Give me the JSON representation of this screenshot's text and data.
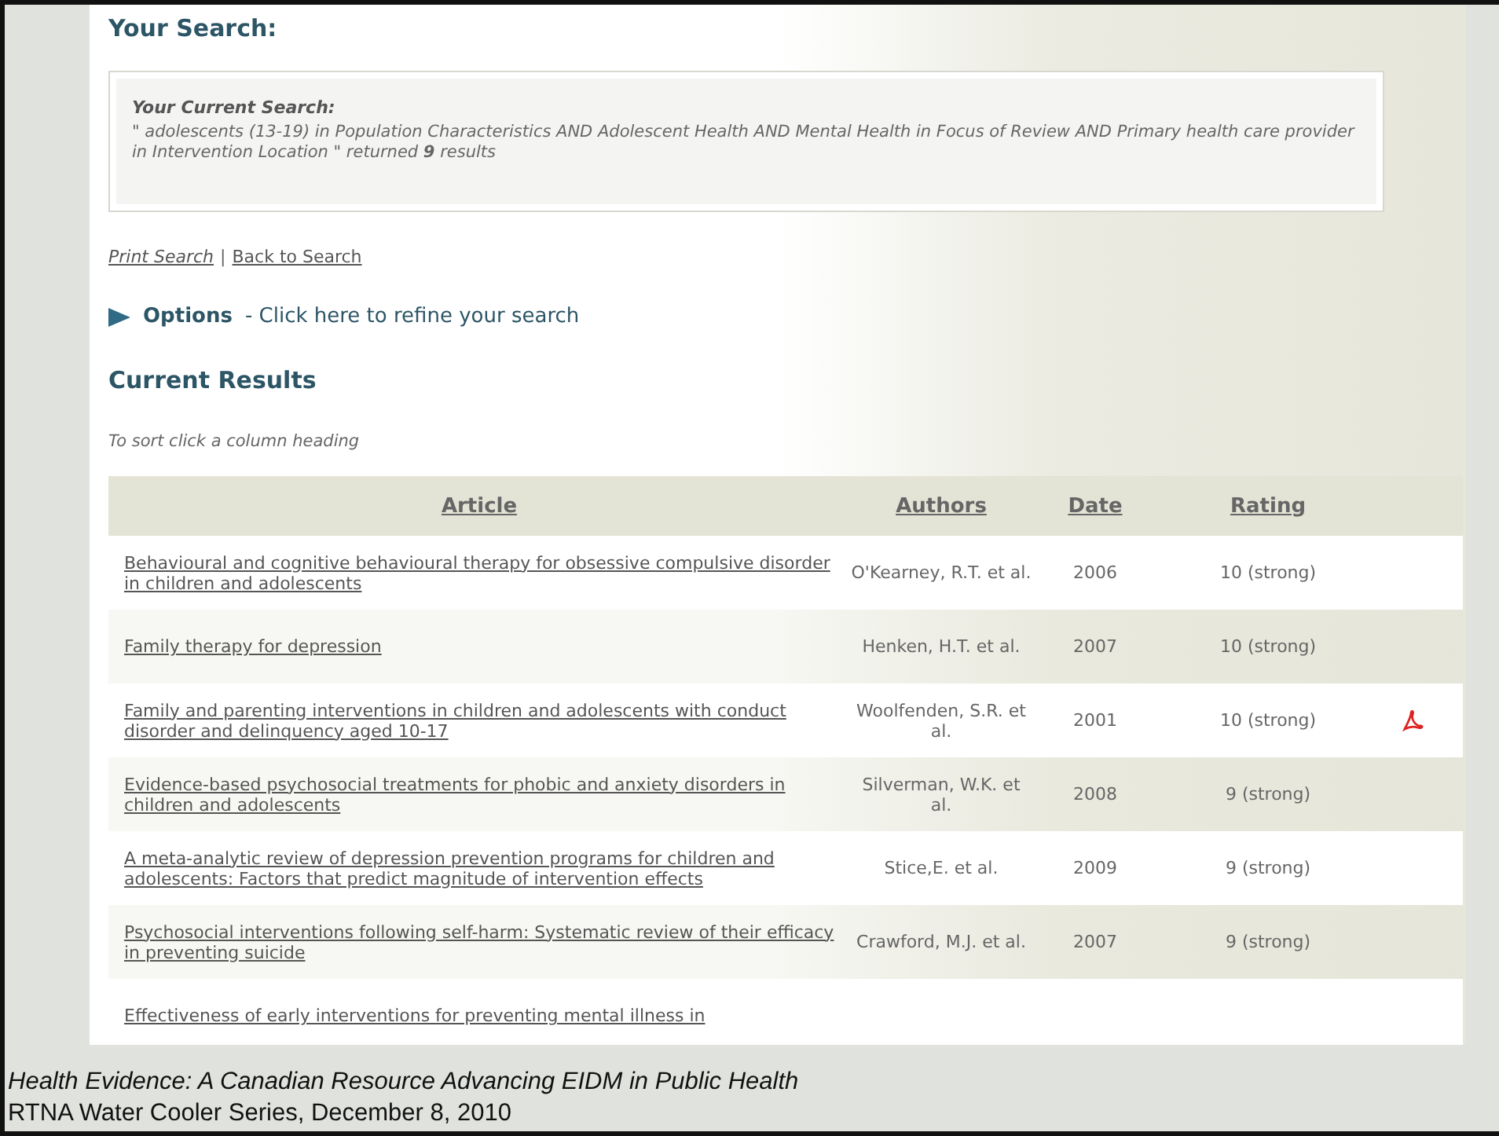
{
  "heading": "Your Search:",
  "current_search": {
    "title": "Your Current Search:",
    "query": "\" adolescents (13-19) in Population Characteristics AND Adolescent Health AND Mental Health in Focus of Review AND Primary health care provider in Intervention Location \" returned **9** results"
  },
  "links": [
    "Print Search",
    "Back to Search"
  ],
  "link_separator": "|",
  "options": {
    "label": "Options",
    "hint": "- Click here to refine your search"
  },
  "results_heading": "Current Results",
  "sort_hint": "To sort click a column heading",
  "table": {
    "columns": [
      "Article",
      "Authors",
      "Date",
      "Rating"
    ],
    "rows": [
      {
        "article": "Behavioural and cognitive behavioural therapy for obsessive compulsive disorder in children and adolescents",
        "authors": "O'Kearney, R.T. et al.",
        "date": "2006",
        "rating": "10 (strong)",
        "pdf": false
      },
      {
        "article": "Family therapy for depression",
        "authors": "Henken, H.T. et al.",
        "date": "2007",
        "rating": "10 (strong)",
        "pdf": false
      },
      {
        "article": "Family and parenting interventions in children and adolescents with conduct disorder and delinquency aged 10-17",
        "authors": "Woolfenden, S.R. et al.",
        "date": "2001",
        "rating": "10 (strong)",
        "pdf": true
      },
      {
        "article": "Evidence-based psychosocial treatments for phobic and anxiety disorders in children and adolescents",
        "authors": "Silverman, W.K. et al.",
        "date": "2008",
        "rating": "9 (strong)",
        "pdf": false
      },
      {
        "article": "A meta-analytic review of depression prevention programs for children and adolescents: Factors that predict magnitude of intervention effects",
        "authors": "Stice,E. et al.",
        "date": "2009",
        "rating": "9 (strong)",
        "pdf": false
      },
      {
        "article": "Psychosocial interventions following self-harm: Systematic review of their efficacy in preventing suicide",
        "authors": "Crawford, M.J. et al.",
        "date": "2007",
        "rating": "9 (strong)",
        "pdf": false
      },
      {
        "article": "Effectiveness of early interventions for preventing mental illness in",
        "pdf": false
      }
    ]
  },
  "footer": [
    "Health Evidence: A Canadian Resource Advancing EIDM in Public Health",
    "RTNA Water Cooler Series, December 8, 2010"
  ]
}
